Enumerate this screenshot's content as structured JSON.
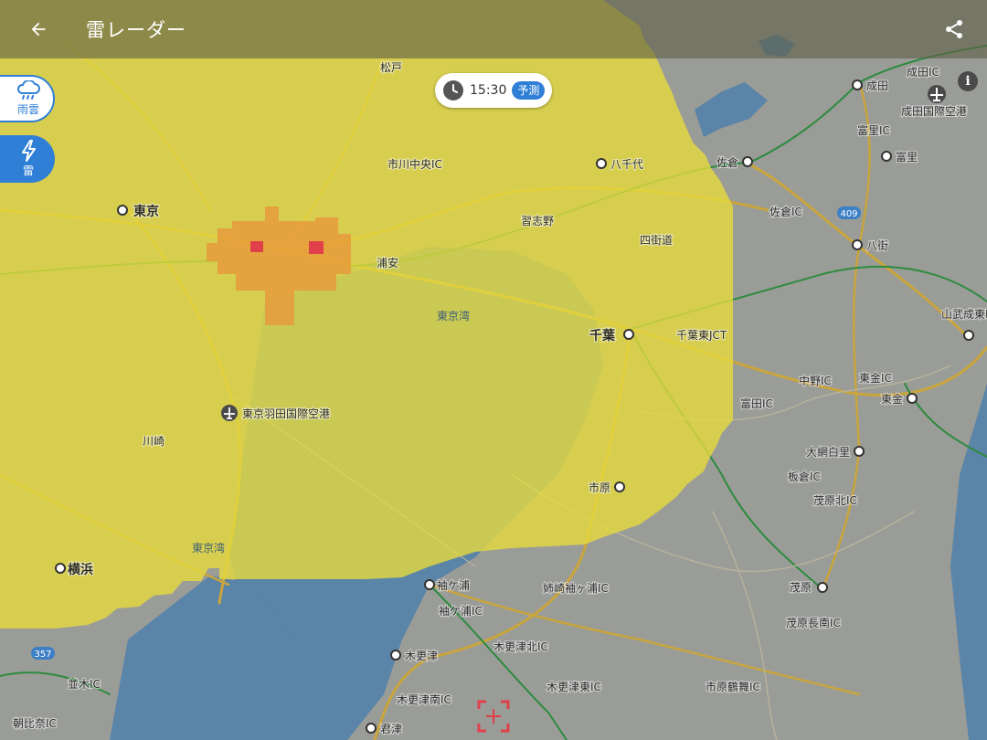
{
  "header": {
    "title": "雷レーダー",
    "back_icon": "arrow-left-icon",
    "share_icon": "share-icon"
  },
  "time_control": {
    "time": "15:30",
    "badge": "予測",
    "icon": "clock-icon"
  },
  "modes": [
    {
      "label": "雨雲",
      "icon": "cloud-rain-icon",
      "active": false
    },
    {
      "label": "雷",
      "icon": "lightning-icon",
      "active": true
    }
  ],
  "info_icon_text": "i",
  "colors": {
    "accent": "#2f7fd6",
    "thunder_low": "#e8dc3c",
    "thunder_mid": "#e69a3a",
    "thunder_high": "#e0404a",
    "sea": "#5a84a8",
    "land": "#9a9c98"
  },
  "map_labels": {
    "tokyo": "東京",
    "chiba": "千葉",
    "yokohama": "横浜",
    "kawasaki": "川崎",
    "narita": "成田",
    "narita_airport": "成田国際空港",
    "narita_ic": "成田IC",
    "tomisato_ic": "富里IC",
    "tomisato": "富里",
    "sakura": "佐倉",
    "sakura_ic": "佐倉IC",
    "yachiyo": "八千代",
    "yachimata": "八街",
    "yotsukaido": "四街道",
    "narashino": "習志野",
    "urayasu": "浦安",
    "ichikawa_chuo_ic": "市川中央IC",
    "haneda": "東京羽田国際空港",
    "ichihara": "市原",
    "sodegaura": "袖ケ浦",
    "sodegaura_ic": "袖ケ浦IC",
    "anegasaki_ic": "姉崎袖ヶ浦IC",
    "kisarazu": "木更津",
    "kisarazu_north_ic": "木更津北IC",
    "kisarazu_east_ic": "木更津東IC",
    "kisarazu_south_ic": "木更津南IC",
    "ichihara_tsurumai_ic": "市原鶴舞IC",
    "kimitsu": "君津",
    "mobara": "茂原",
    "mobara_nagara_ic": "茂原長南IC",
    "mobara_kita_ic": "茂原北IC",
    "oamishirasato": "大網白里",
    "itakura_ic": "板倉IC",
    "togane": "東金",
    "togane_ic": "東金IC",
    "nakano_ic": "中野IC",
    "sanmu_ic": "山武成東IC",
    "tomida_ic": "富田IC",
    "kamagaya": "松戸",
    "tokyo_bay": "東京湾",
    "chiba_east_jct": "千葉東JCT",
    "route_409": "409",
    "route_357": "357",
    "futtsu_ic": "木更津南IC",
    "kanagawa_bay": "東京湾",
    "namiki_ic": "並木IC",
    "asahina_ic": "朝比奈IC"
  }
}
